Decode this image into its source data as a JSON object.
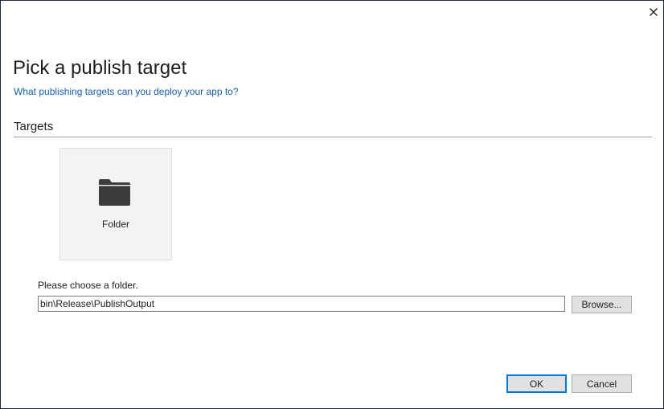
{
  "dialog": {
    "title": "Pick a publish target",
    "subtitle": "What publishing targets can you deploy your app to?",
    "close_icon": "close-icon"
  },
  "targets": {
    "header": "Targets",
    "items": [
      {
        "label": "Folder",
        "icon": "folder-icon",
        "icon_color": "#3c3c3c"
      }
    ]
  },
  "folder": {
    "prompt": "Please choose a folder.",
    "path_value": "bin\\Release\\PublishOutput",
    "browse_label": "Browse..."
  },
  "footer": {
    "ok_label": "OK",
    "cancel_label": "Cancel"
  },
  "colors": {
    "link": "#1a5fa8",
    "tile_background": "#f3f3f3",
    "default_button_border": "#0078d7"
  }
}
